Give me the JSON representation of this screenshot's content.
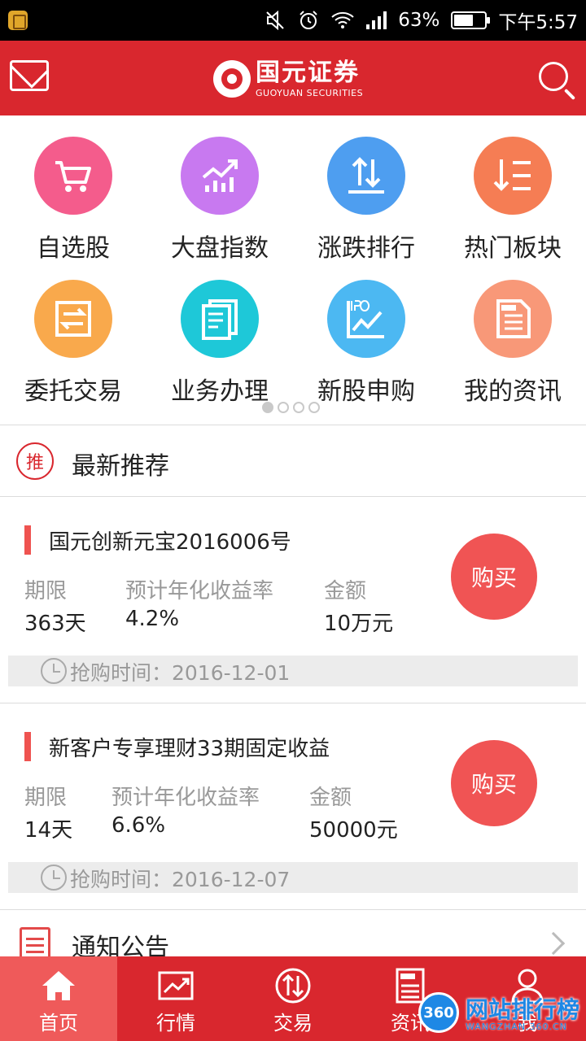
{
  "status_bar": {
    "battery": "63%",
    "battery_level": 0.63,
    "time": "下午5:57"
  },
  "header": {
    "logo_cn": "国元证券",
    "logo_en": "GUOYUAN SECURITIES"
  },
  "grid": {
    "items": [
      {
        "label": "自选股",
        "icon": "cart-icon",
        "color": "#f45c8c"
      },
      {
        "label": "大盘指数",
        "icon": "chart-rising-icon",
        "color": "#c879f0"
      },
      {
        "label": "涨跌排行",
        "icon": "up-down-arrows-icon",
        "color": "#4e9ef0"
      },
      {
        "label": "热门板块",
        "icon": "sort-list-icon",
        "color": "#f57d54"
      },
      {
        "label": "委托交易",
        "icon": "exchange-icon",
        "color": "#f9a94c"
      },
      {
        "label": "业务办理",
        "icon": "documents-icon",
        "color": "#1ec8d8"
      },
      {
        "label": "新股申购",
        "icon": "ipo-chart-icon",
        "color": "#4cb8f2"
      },
      {
        "label": "我的资讯",
        "icon": "news-icon",
        "color": "#f89878"
      }
    ],
    "page_count": 4,
    "active_page": 1
  },
  "recommend": {
    "badge": "推",
    "title": "最新推荐"
  },
  "products": [
    {
      "title": "国元创新元宝2016006号",
      "term_label": "期限",
      "term_value": "363天",
      "rate_label": "预计年化收益率",
      "rate_value": "4.2%",
      "amount_label": "金额",
      "amount_value": "10万元",
      "buy_label": "购买",
      "time_text": "抢购时间：2016-12-01"
    },
    {
      "title": "新客户专享理财33期固定收益",
      "term_label": "期限",
      "term_value": "14天",
      "rate_label": "预计年化收益率",
      "rate_value": "6.6%",
      "amount_label": "金额",
      "amount_value": "50000元",
      "buy_label": "购买",
      "time_text": "抢购时间：2016-12-07"
    }
  ],
  "notice": {
    "title": "通知公告"
  },
  "bottom_nav": [
    {
      "label": "首页",
      "icon": "home-icon",
      "active": true
    },
    {
      "label": "行情",
      "icon": "market-chart-icon",
      "active": false
    },
    {
      "label": "交易",
      "icon": "trade-arrows-icon",
      "active": false
    },
    {
      "label": "资讯",
      "icon": "news-icon",
      "active": false
    },
    {
      "label": "我",
      "icon": "user-icon",
      "active": false
    }
  ],
  "watermark": {
    "badge": "360",
    "text": "网站排行榜",
    "url": "WANGZHAN.360.CN"
  },
  "colors": {
    "brand_red": "#d9272e",
    "buy_red": "#f05454"
  }
}
